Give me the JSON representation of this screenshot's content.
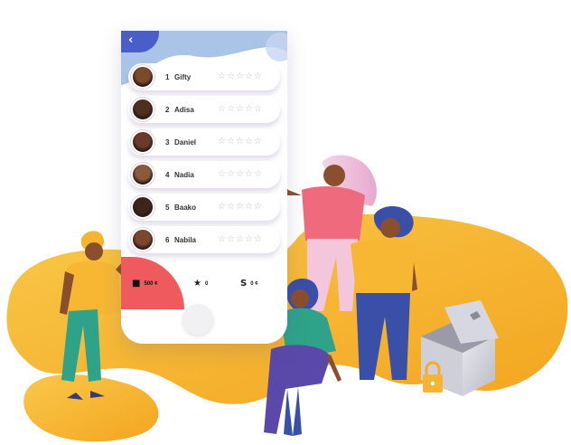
{
  "leaderboard": {
    "rows": [
      {
        "rank": "1",
        "name": "Gifty",
        "rating": 0,
        "avatar_color": "#7a4a2c"
      },
      {
        "rank": "2",
        "name": "Adisa",
        "rating": 0,
        "avatar_color": "#4e2e1f"
      },
      {
        "rank": "3",
        "name": "Daniel",
        "rating": 0,
        "avatar_color": "#6b3a2a"
      },
      {
        "rank": "4",
        "name": "Nadia",
        "rating": 0,
        "avatar_color": "#8a5a3c"
      },
      {
        "rank": "5",
        "name": "Baako",
        "rating": 0,
        "avatar_color": "#3f2418"
      },
      {
        "rank": "6",
        "name": "Nabila",
        "rating": 0,
        "avatar_color": "#7d4630"
      }
    ],
    "max_stars": 5
  },
  "footer": {
    "coins_value": "500 ¢",
    "stars_value": "0",
    "s_value": "0 ¢"
  },
  "icons": {
    "back": "chevron-left-icon",
    "coins": "cube-icon",
    "stars": "star-icon",
    "s": "s-icon",
    "home": "home-button"
  },
  "colors": {
    "header_blue": "#a9c4e6",
    "back_button": "#4a5ec9",
    "footer_red": "#ef5a5f",
    "blob_yellow": "#f6b22a",
    "pink_shirt": "#f06a7d",
    "yellow_shirt": "#f7b733",
    "blue_pants": "#3a4fa8",
    "green_outfit": "#2fa38a",
    "purple_skirt": "#5a49a8"
  }
}
